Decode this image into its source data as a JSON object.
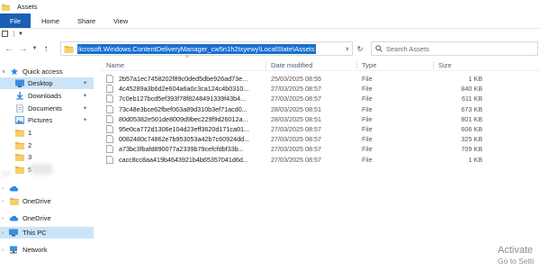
{
  "window": {
    "title": "Assets"
  },
  "ribbon": {
    "file": "File",
    "tabs": [
      "Home",
      "Share",
      "View"
    ]
  },
  "address": {
    "path": "licrosoft.Windows.ContentDeliveryManager_cw5n1h2txyewy\\LocalState\\Assets",
    "search_placeholder": "Search Assets"
  },
  "sidebar": {
    "quick_access": "Quick access",
    "items": [
      {
        "label": "Desktop",
        "icon": "desktop-icon",
        "pinned": true
      },
      {
        "label": "Downloads",
        "icon": "downloads-icon",
        "pinned": true
      },
      {
        "label": "Documents",
        "icon": "documents-icon",
        "pinned": true
      },
      {
        "label": "Pictures",
        "icon": "pictures-icon",
        "pinned": true
      },
      {
        "label": "1",
        "icon": "folder-icon",
        "pinned": false
      },
      {
        "label": "2",
        "icon": "folder-icon",
        "pinned": false
      },
      {
        "label": "3",
        "icon": "folder-icon",
        "pinned": false
      },
      {
        "label": "5",
        "icon": "folder-icon",
        "pinned": false
      }
    ],
    "onedrive_personal": "OneDrive",
    "onedrive": "OneDrive",
    "this_pc": "This PC",
    "network": "Network"
  },
  "columns": {
    "name": "Name",
    "date": "Date modified",
    "type": "Type",
    "size": "Size"
  },
  "files": [
    {
      "name": "2b57a1ec7458202f89c0ded5dbe926ad73e...",
      "date": "25/03/2025 08:55",
      "type": "File",
      "size": "1 KB"
    },
    {
      "name": "4c45289a3b6d2e604a6a0c3ca124c4b0310...",
      "date": "27/03/2025 08:57",
      "type": "File",
      "size": "840 KB"
    },
    {
      "name": "7c0eb127bcd5ef393f78f8248491339f43b4...",
      "date": "27/03/2025 08:57",
      "type": "File",
      "size": "611 KB"
    },
    {
      "name": "73c48e3bce62fbef063a89d310b3ef71acd0...",
      "date": "28/03/2025 08:51",
      "type": "File",
      "size": "673 KB"
    },
    {
      "name": "80d05382e501de8009d9bec229f9d26012a...",
      "date": "28/03/2025 08:51",
      "type": "File",
      "size": "801 KB"
    },
    {
      "name": "95e0ca772d1306e104d23eff3620d171ca01...",
      "date": "27/03/2025 08:57",
      "type": "File",
      "size": "606 KB"
    },
    {
      "name": "0082480c74862e7b953053a42b7c60924dd...",
      "date": "27/03/2025 08:57",
      "type": "File",
      "size": "325 KB"
    },
    {
      "name": "a73bc3fbafd890077a2339b79cefcfdbf33b...",
      "date": "27/03/2025 08:57",
      "type": "File",
      "size": "709 KB"
    },
    {
      "name": "cacc8cc8aa419b4643921b4b65357041d6d...",
      "date": "27/03/2025 08:57",
      "type": "File",
      "size": "1 KB"
    }
  ],
  "watermark": {
    "line1": "Activate",
    "line2": "Go to Setti"
  },
  "colors": {
    "accent": "#1a5fb4",
    "selection": "#cce4f7",
    "folder": "#e8b84a",
    "header_text": "#4c607a"
  }
}
